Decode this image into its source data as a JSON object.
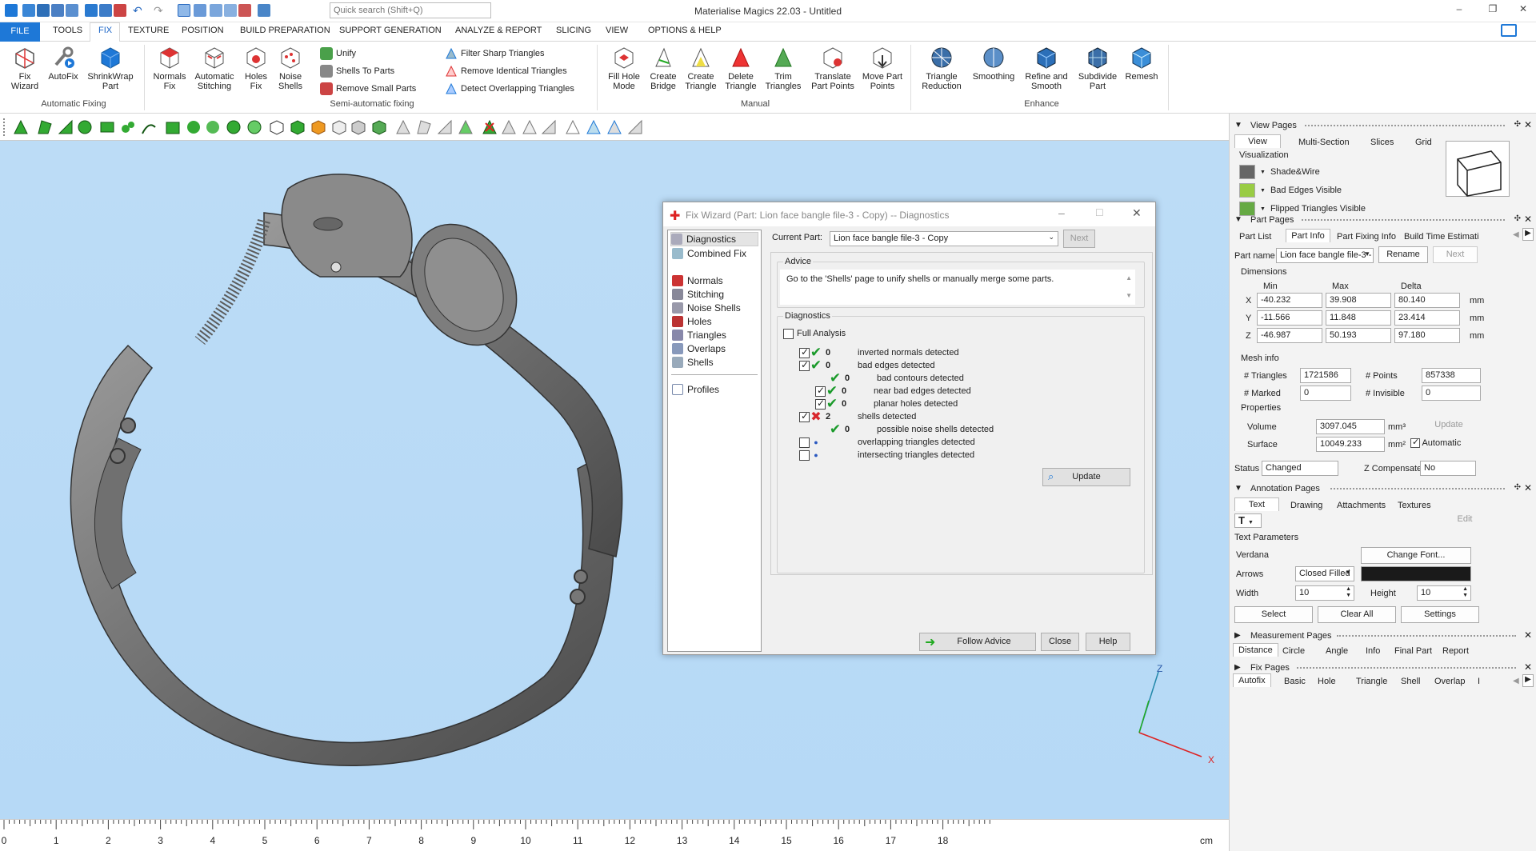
{
  "titlebar": {
    "app_title": "Materialise Magics 22.03 - Untitled",
    "search_placeholder": "Quick search (Shift+Q)"
  },
  "menu": {
    "tabs": [
      "FILE",
      "TOOLS",
      "FIX",
      "TEXTURE",
      "POSITION",
      "BUILD PREPARATION",
      "SUPPORT GENERATION",
      "ANALYZE & REPORT",
      "SLICING",
      "VIEW",
      "OPTIONS & HELP"
    ],
    "active": "FIX"
  },
  "ribbon": {
    "automatic_fixing": {
      "group_label": "Automatic Fixing",
      "buttons": [
        "Fix\nWizard",
        "AutoFix",
        "ShrinkWrap\nPart"
      ]
    },
    "semi_automatic": {
      "group_label": "Semi-automatic fixing",
      "buttons": [
        "Normals\nFix",
        "Automatic\nStitching",
        "Holes\nFix",
        "Noise\nShells"
      ],
      "small": [
        "Unify",
        "Shells To Parts",
        "Remove Small Parts"
      ],
      "small2": [
        "Filter Sharp Triangles",
        "Remove Identical Triangles",
        "Detect Overlapping Triangles"
      ]
    },
    "manual": {
      "group_label": "Manual",
      "buttons": [
        "Fill Hole\nMode",
        "Create\nBridge",
        "Create\nTriangle",
        "Delete\nTriangle",
        "Trim\nTriangles",
        "Translate\nPart Points",
        "Move Part\nPoints"
      ]
    },
    "enhance": {
      "group_label": "Enhance",
      "buttons": [
        "Triangle\nReduction",
        "Smoothing",
        "Refine and\nSmooth",
        "Subdivide\nPart",
        "Remesh"
      ]
    }
  },
  "ruler": {
    "labels": [
      "0",
      "1",
      "2",
      "3",
      "4",
      "5",
      "6",
      "7",
      "8",
      "9",
      "10",
      "11",
      "12",
      "13",
      "14",
      "15",
      "16",
      "17",
      "18"
    ],
    "unit": "cm"
  },
  "axes": {
    "z": "Z",
    "x": "X"
  },
  "dialog": {
    "title": "Fix Wizard (Part: Lion face bangle file-3 - Copy) -- Diagnostics",
    "nav": [
      "Diagnostics",
      "Combined Fix",
      "Normals",
      "Stitching",
      "Noise Shells",
      "Holes",
      "Triangles",
      "Overlaps",
      "Shells",
      "Profiles"
    ],
    "current_part_label": "Current Part:",
    "current_part": "Lion face bangle file-3 - Copy",
    "next": "Next",
    "advice_label": "Advice",
    "advice_text": "Go to the 'Shells' page to unify shells or manually merge some parts.",
    "diagnostics_label": "Diagnostics",
    "full_analysis": "Full Analysis",
    "rows": [
      {
        "num": "0",
        "text": "inverted normals detected"
      },
      {
        "num": "0",
        "text": "bad edges detected"
      },
      {
        "num": "0",
        "text": "bad contours detected"
      },
      {
        "num": "0",
        "text": "near bad edges detected"
      },
      {
        "num": "0",
        "text": "planar holes detected"
      },
      {
        "num": "2",
        "text": "shells detected"
      },
      {
        "num": "0",
        "text": "possible noise shells detected"
      },
      {
        "num": "",
        "text": "overlapping triangles detected"
      },
      {
        "num": "",
        "text": "intersecting triangles detected"
      }
    ],
    "update": "Update",
    "follow_advice": "Follow Advice",
    "close": "Close",
    "help": "Help"
  },
  "view_pages": {
    "title": "View Pages",
    "tabs": [
      "View",
      "Multi-Section",
      "Slices",
      "Grid"
    ],
    "visualization_label": "Visualization",
    "items": [
      "Shade&Wire",
      "Bad Edges Visible",
      "Flipped Triangles Visible"
    ]
  },
  "part_pages": {
    "title": "Part Pages",
    "tabs": [
      "Part List",
      "Part Info",
      "Part Fixing Info",
      "Build Time Estimatio"
    ],
    "part_name_label": "Part name",
    "part_name": "Lion face bangle file-3 -",
    "rename": "Rename",
    "next": "Next",
    "dimensions_label": "Dimensions",
    "col_min": "Min",
    "col_max": "Max",
    "col_delta": "Delta",
    "unit": "mm",
    "rows": [
      {
        "axis": "X",
        "min": "-40.232",
        "max": "39.908",
        "delta": "80.140"
      },
      {
        "axis": "Y",
        "min": "-11.566",
        "max": "11.848",
        "delta": "23.414"
      },
      {
        "axis": "Z",
        "min": "-46.987",
        "max": "50.193",
        "delta": "97.180"
      }
    ],
    "mesh_label": "Mesh info",
    "triangles_label": "# Triangles",
    "triangles": "1721586",
    "points_label": "# Points",
    "points": "857338",
    "marked_label": "# Marked",
    "marked": "0",
    "invisible_label": "# Invisible",
    "invisible": "0",
    "properties_label": "Properties",
    "volume_label": "Volume",
    "volume": "3097.045",
    "volume_unit": "mm³",
    "surface_label": "Surface",
    "surface": "10049.233",
    "surface_unit": "mm²",
    "update": "Update",
    "automatic": "Automatic",
    "status_label": "Status",
    "status": "Changed",
    "zcomp_label": "Z Compensated",
    "zcomp": "No"
  },
  "annotation_pages": {
    "title": "Annotation Pages",
    "tabs": [
      "Text",
      "Drawing",
      "Attachments",
      "Textures"
    ],
    "edit": "Edit",
    "text_params": "Text Parameters",
    "font": "Verdana",
    "change_font": "Change Font...",
    "arrows_label": "Arrows",
    "arrows": "Closed Filled",
    "width_label": "Width",
    "width": "10",
    "height_label": "Height",
    "height": "10",
    "select": "Select",
    "clear_all": "Clear All",
    "settings": "Settings"
  },
  "measurement_pages": {
    "title": "Measurement Pages",
    "tabs": [
      "Distance",
      "Circle",
      "Angle",
      "Info",
      "Final Part",
      "Report"
    ]
  },
  "fix_pages": {
    "title": "Fix Pages",
    "tabs": [
      "Autofix",
      "Basic",
      "Hole",
      "Triangle",
      "Shell",
      "Overlap",
      "I"
    ]
  },
  "colors": {
    "accent": "#1e78d7",
    "viewport": "#b8dbf6",
    "check_green": "#1a9a2a",
    "cross_red": "#d8262c"
  }
}
